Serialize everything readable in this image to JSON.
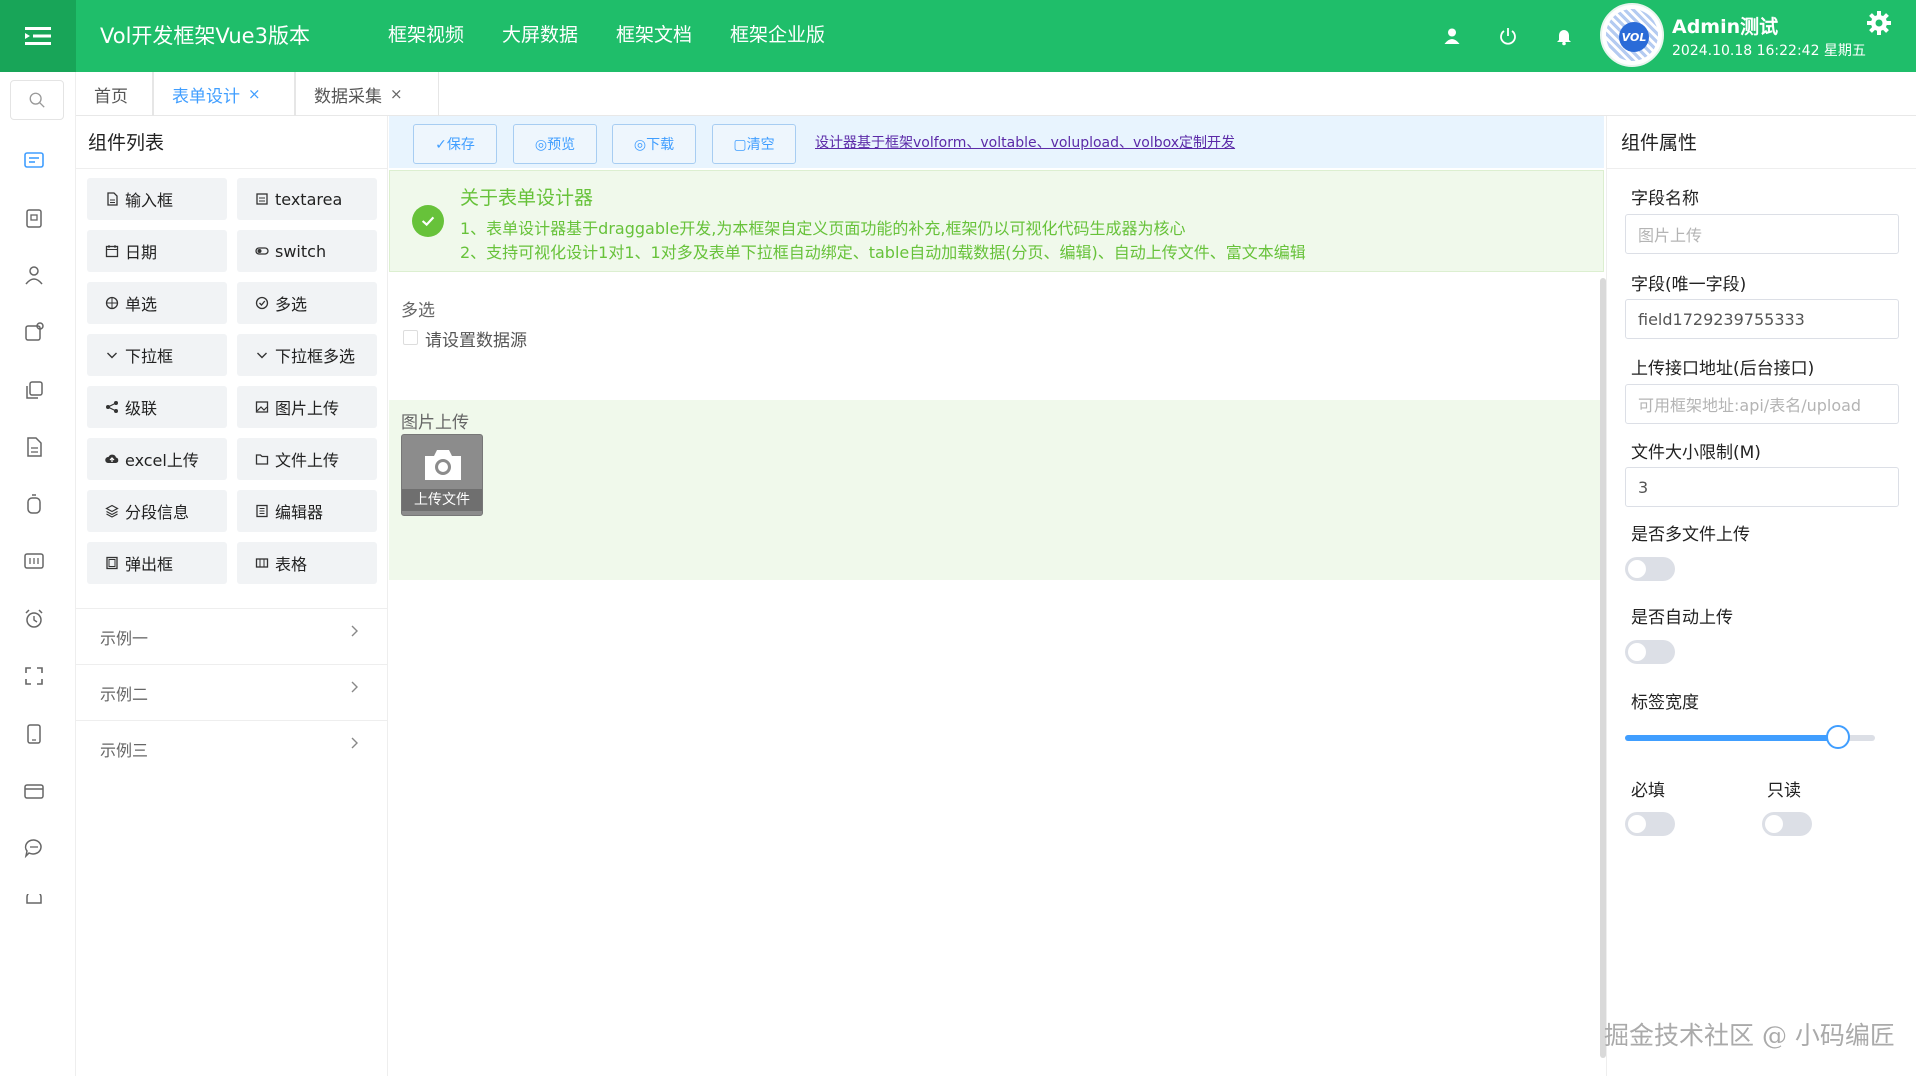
{
  "header": {
    "app_title": "Vol开发框架Vue3版本",
    "nav": [
      "框架视频",
      "大屏数据",
      "框架文档",
      "框架企业版"
    ],
    "avatar_text": "VOL",
    "user_name": "Admin测试",
    "datetime": "2024.10.18 16:22:42 星期五"
  },
  "tabs": [
    {
      "label": "首页",
      "closable": false
    },
    {
      "label": "表单设计",
      "closable": true,
      "active": true
    },
    {
      "label": "数据采集",
      "closable": true
    }
  ],
  "close_glyph": "×",
  "components": {
    "title": "组件列表",
    "items": [
      {
        "label": "输入框",
        "icon": "document-icon"
      },
      {
        "label": "textarea",
        "icon": "notes-icon"
      },
      {
        "label": "日期",
        "icon": "calendar-icon"
      },
      {
        "label": "switch",
        "icon": "switch-icon"
      },
      {
        "label": "单选",
        "icon": "target-icon"
      },
      {
        "label": "多选",
        "icon": "circle-check-icon"
      },
      {
        "label": "下拉框",
        "icon": "chevron-down-icon"
      },
      {
        "label": "下拉框多选",
        "icon": "chevron-down-icon"
      },
      {
        "label": "级联",
        "icon": "share-icon"
      },
      {
        "label": "图片上传",
        "icon": "image-icon"
      },
      {
        "label": "excel上传",
        "icon": "cloud-upload-icon"
      },
      {
        "label": "文件上传",
        "icon": "folder-icon"
      },
      {
        "label": "分段信息",
        "icon": "stack-icon"
      },
      {
        "label": "编辑器",
        "icon": "editor-icon"
      },
      {
        "label": "弹出框",
        "icon": "popup-icon"
      },
      {
        "label": "表格",
        "icon": "table-icon"
      }
    ],
    "examples": [
      "示例一",
      "示例二",
      "示例三"
    ]
  },
  "toolbar": {
    "save": "✓保存",
    "preview": "◎预览",
    "download": "◎下载",
    "clear": "▢清空",
    "link": "设计器基于框架volform、voltable、volupload、volbox定制开发"
  },
  "alert": {
    "title": "关于表单设计器",
    "line1": "1、表单设计器基于draggable开发,为本框架自定义页面功能的补充,框架仍以可视化代码生成器为核心",
    "line2": "2、支持可视化设计1对1、1对多及表单下拉框自动绑定、table自动加载数据(分页、编辑)、自动上传文件、富文本编辑"
  },
  "canvas": {
    "checkbox_label": "多选",
    "checkbox_hint": "请设置数据源",
    "upload_label": "图片上传",
    "upload_button": "上传文件"
  },
  "props": {
    "title": "组件属性",
    "field_name_label": "字段名称",
    "field_name_value": "图片上传",
    "field_key_label": "字段(唯一字段)",
    "field_key_value": "field1729239755333",
    "upload_url_label": "上传接口地址(后台接口)",
    "upload_url_placeholder": "可用框架地址:api/表名/upload",
    "size_limit_label": "文件大小限制(M)",
    "size_limit_value": "3",
    "multi_upload_label": "是否多文件上传",
    "multi_upload_on": false,
    "auto_upload_label": "是否自动上传",
    "auto_upload_on": false,
    "label_width_label": "标签宽度",
    "label_width_fraction": 0.85,
    "required_label": "必填",
    "required_on": false,
    "readonly_label": "只读",
    "readonly_on": false
  },
  "watermark": "掘金技术社区 @ 小码编匠",
  "colors": {
    "header_bg": "#1fbe6a",
    "accent": "#409eff",
    "success": "#67c23a"
  }
}
